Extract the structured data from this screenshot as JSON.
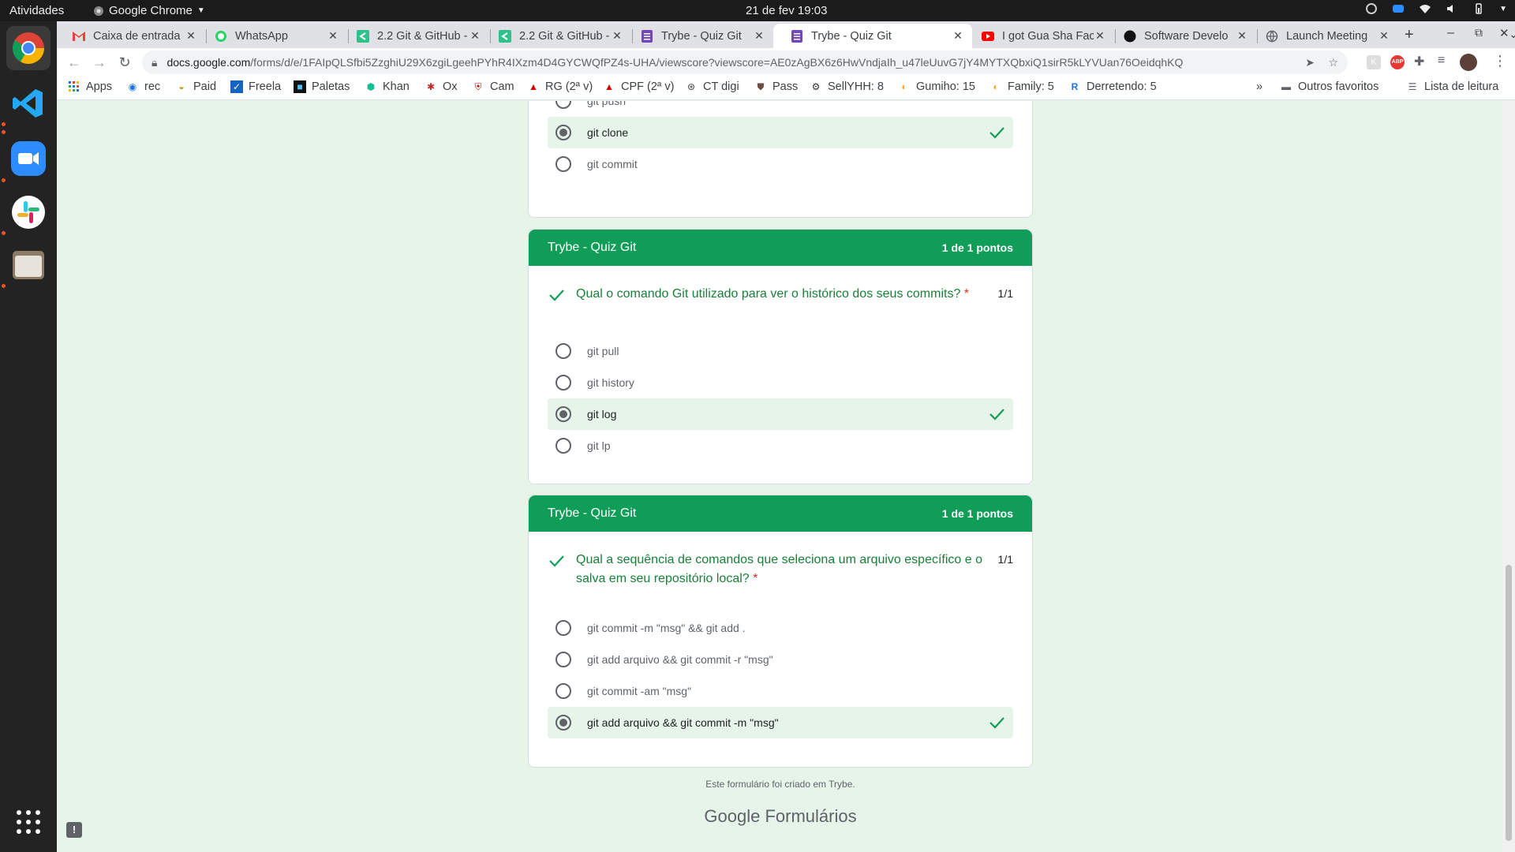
{
  "topbar": {
    "activities": "Atividades",
    "app_name": "Google Chrome",
    "clock": "21 de fev  19:03"
  },
  "dock": {
    "items": [
      "chrome-icon",
      "vscode-icon",
      "zoom-icon",
      "slack-icon",
      "files-icon",
      "app-grid-icon"
    ]
  },
  "tabs": [
    {
      "title": "Caixa de entrada",
      "icon": "gmail-icon"
    },
    {
      "title": "WhatsApp",
      "icon": "whatsapp-icon"
    },
    {
      "title": "2.2 Git & GitHub -",
      "icon": "trybe-icon"
    },
    {
      "title": "2.2 Git & GitHub -",
      "icon": "trybe-icon"
    },
    {
      "title": "Trybe - Quiz Git",
      "icon": "forms-icon"
    },
    {
      "title": "Trybe - Quiz Git",
      "icon": "forms-icon",
      "active": true
    },
    {
      "title": "I got Gua Sha Fac",
      "icon": "youtube-icon"
    },
    {
      "title": "Software Develo",
      "icon": "github-icon"
    },
    {
      "title": "Launch Meeting",
      "icon": "globe-icon"
    }
  ],
  "toolbar": {
    "url_host": "docs.google.com",
    "url_path": "/forms/d/e/1FAIpQLSfbi5ZzghiU29X6zgiLgeehPYhR4IXzm4D4GYCWQfPZ4s-UHA/viewscore?viewscore=AE0zAgBX6z6HwVndjaIh_u47leUuvG7jY4MYTXQbxiQ1sirR5kLYVUan76OeidqhKQ"
  },
  "bookmarks": [
    {
      "label": "Apps",
      "icon": "apps-grid-icon"
    },
    {
      "label": "rec",
      "icon": "rec-icon"
    },
    {
      "label": "Paid",
      "icon": "paid-icon"
    },
    {
      "label": "Freela",
      "icon": "freela-icon"
    },
    {
      "label": "Paletas",
      "icon": "paletas-icon"
    },
    {
      "label": "Khan",
      "icon": "khan-icon"
    },
    {
      "label": "Ox",
      "icon": "ox-icon"
    },
    {
      "label": "Cam",
      "icon": "cam-icon"
    },
    {
      "label": "RG (2ª v)",
      "icon": "rg-icon"
    },
    {
      "label": "CPF (2ª v)",
      "icon": "cpf-icon"
    },
    {
      "label": "CT digi",
      "icon": "ct-icon"
    },
    {
      "label": "Pass",
      "icon": "pass-icon"
    },
    {
      "label": "SellYHH: 8",
      "icon": "sell-icon"
    },
    {
      "label": "Gumiho: 15",
      "icon": "gumiho-icon"
    },
    {
      "label": "Family: 5",
      "icon": "family-icon"
    },
    {
      "label": "Derretendo: 5",
      "icon": "derretendo-icon"
    }
  ],
  "bookmarks_right": {
    "more": "»",
    "other": "Outros favoritos",
    "reading": "Lista de leitura"
  },
  "card0": {
    "options": [
      {
        "label": "git push",
        "selected": false
      },
      {
        "label": "git clone",
        "selected": true,
        "correct": true
      },
      {
        "label": "git commit",
        "selected": false
      }
    ]
  },
  "card1": {
    "header": "Trybe - Quiz Git",
    "points": "1 de 1 pontos",
    "question": "Qual o comando Git utilizado para ver o histórico dos seus commits?",
    "required": "*",
    "score": "1/1",
    "options": [
      {
        "label": "git pull",
        "selected": false
      },
      {
        "label": "git history",
        "selected": false
      },
      {
        "label": "git log",
        "selected": true,
        "correct": true
      },
      {
        "label": "git lp",
        "selected": false
      }
    ]
  },
  "card2": {
    "header": "Trybe - Quiz Git",
    "points": "1 de 1 pontos",
    "question": "Qual a sequência de comandos que seleciona um arquivo específico e o salva em seu repositório local?",
    "required": "*",
    "score": "1/1",
    "options": [
      {
        "label": "git commit -m \"msg\" && git add .",
        "selected": false
      },
      {
        "label": "git add arquivo && git commit -r \"msg\"",
        "selected": false
      },
      {
        "label": "git commit -am \"msg\"",
        "selected": false
      },
      {
        "label": "git add arquivo && git commit -m \"msg\"",
        "selected": true,
        "correct": true
      }
    ]
  },
  "footer": {
    "note": "Este formulário foi criado em Trybe.",
    "logo_google": "Google",
    "logo_product": "Formulários"
  },
  "colors": {
    "accent": "#0f9d58",
    "page_bg": "#e6f4ea",
    "correct_text": "#188038"
  }
}
